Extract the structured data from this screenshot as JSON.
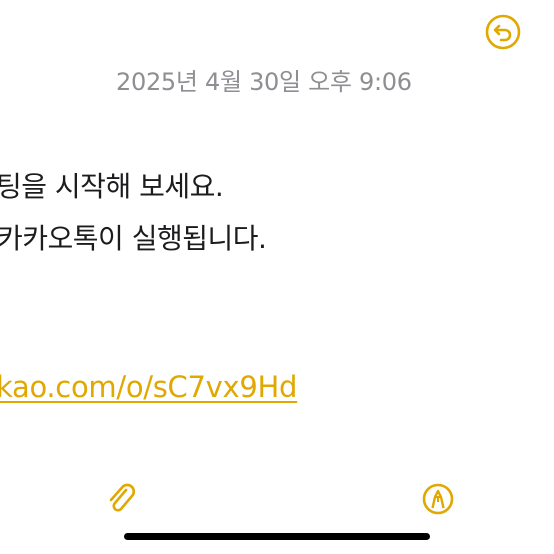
{
  "colors": {
    "accent": "#e0a800",
    "text": "#1c1c1e",
    "timestamp": "#8e8e93",
    "background": "#ffffff"
  },
  "header": {
    "undo_icon": "undo-icon",
    "timestamp": "2025년 4월 30일 오후 9:06"
  },
  "note": {
    "line1": "팅을 시작해 보세요.",
    "line2": "카카오톡이 실행됩니다.",
    "link": "kao.com/o/sC7vx9Hd"
  },
  "toolbar": {
    "attach_icon": "paperclip-icon",
    "markup_icon": "markup-pen-icon"
  }
}
